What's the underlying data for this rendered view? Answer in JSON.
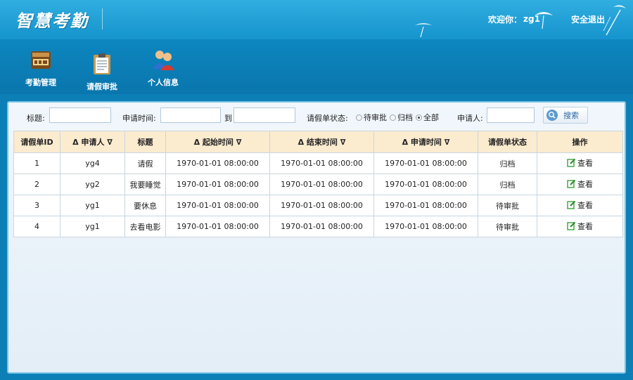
{
  "header": {
    "logo": "智慧考勤",
    "welcome_label": "欢迎你：",
    "username": "zg1",
    "logout": "安全退出"
  },
  "toolbar": {
    "items": [
      {
        "label": "考勤管理",
        "icon": "time-card-icon"
      },
      {
        "label": "请假审批",
        "icon": "clipboard-icon"
      },
      {
        "label": "个人信息",
        "icon": "users-icon"
      }
    ]
  },
  "filter": {
    "title_label": "标题:",
    "title_value": "",
    "apply_time_label": "申请时间:",
    "apply_from": "",
    "to_label": "到",
    "apply_to": "",
    "status_label": "请假单状态:",
    "status_options": [
      "待审批",
      "归档",
      "全部"
    ],
    "status_selected": "全部",
    "applicant_label": "申请人:",
    "applicant_value": "",
    "search_label": "搜索",
    "search_icon": "search-icon"
  },
  "table": {
    "headers": [
      "请假单ID",
      "Δ 申请人 ∇",
      "标题",
      "Δ 起始时间 ∇",
      "Δ 结束时间 ∇",
      "Δ 申请时间 ∇",
      "请假单状态",
      "操作"
    ],
    "rows": [
      {
        "id": "1",
        "applicant": "yg4",
        "title": "请假",
        "start": "1970-01-01 08:00:00",
        "end": "1970-01-01 08:00:00",
        "applied": "1970-01-01 08:00:00",
        "status": "归档",
        "action": "查看"
      },
      {
        "id": "2",
        "applicant": "yg2",
        "title": "我要睡觉",
        "start": "1970-01-01 08:00:00",
        "end": "1970-01-01 08:00:00",
        "applied": "1970-01-01 08:00:00",
        "status": "归档",
        "action": "查看"
      },
      {
        "id": "3",
        "applicant": "yg1",
        "title": "要休息",
        "start": "1970-01-01 08:00:00",
        "end": "1970-01-01 08:00:00",
        "applied": "1970-01-01 08:00:00",
        "status": "待审批",
        "action": "查看"
      },
      {
        "id": "4",
        "applicant": "yg1",
        "title": "去看电影",
        "start": "1970-01-01 08:00:00",
        "end": "1970-01-01 08:00:00",
        "applied": "1970-01-01 08:00:00",
        "status": "待审批",
        "action": "查看"
      }
    ]
  },
  "colors": {
    "header_blue": "#1e9fd6",
    "toolbar_blue": "#0b7fb6",
    "table_header": "#fbebcf",
    "edit_icon_green": "#3aa43a"
  }
}
